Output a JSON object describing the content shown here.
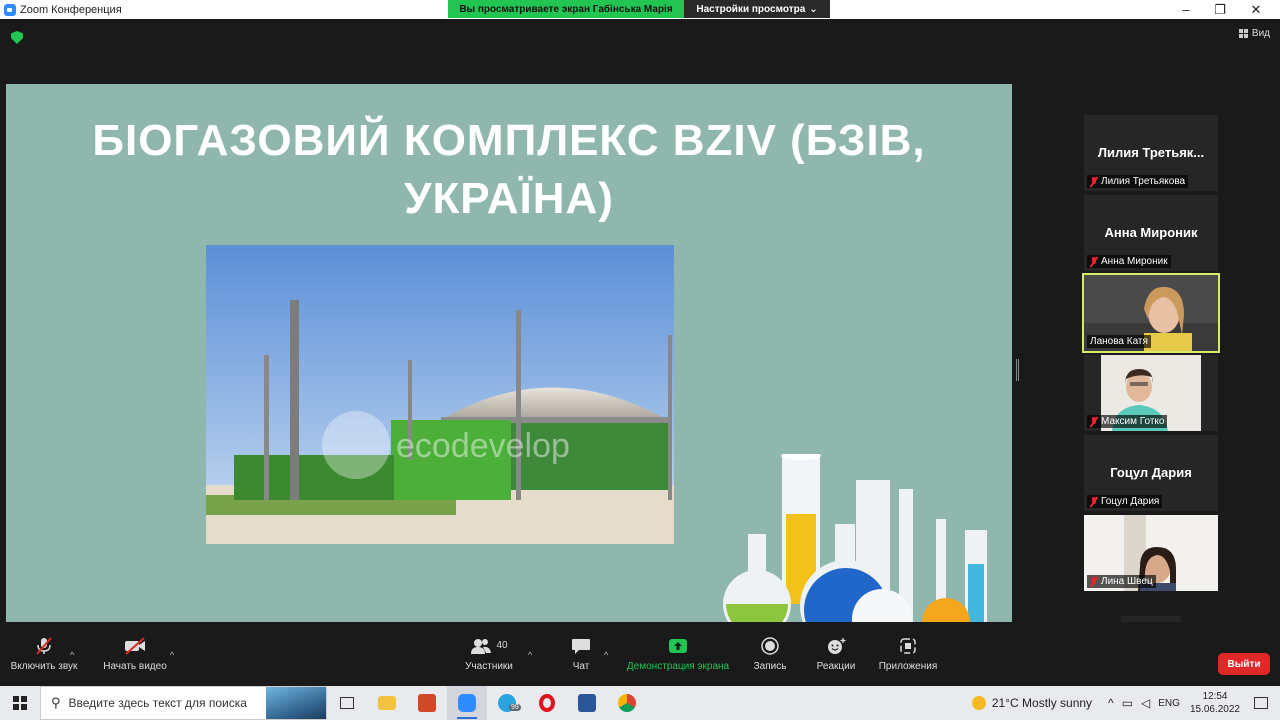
{
  "window": {
    "title": "Zoom Конференция",
    "share_banner": "Вы просматриваете экран Габінська Марія",
    "view_options": "Настройки просмотра",
    "view_button": "Вид"
  },
  "slide": {
    "title_line1": "БІОГАЗОВИЙ КОМПЛЕКС BZIV (БЗІВ,",
    "title_line2": "УКРАЇНА)",
    "photo_watermark": "ecodevelop"
  },
  "participants": [
    {
      "display_name": "Лилия Третьяк...",
      "label": "Лилия Третьякова",
      "muted": true,
      "video": false
    },
    {
      "display_name": "Анна Мироник",
      "label": "Анна Мироник",
      "muted": true,
      "video": false
    },
    {
      "display_name": "",
      "label": "Ланова Катя",
      "muted": false,
      "video": true,
      "active": true
    },
    {
      "display_name": "",
      "label": "Максим Готко",
      "muted": true,
      "video": true
    },
    {
      "display_name": "Гоцул  Дария",
      "label": "Гоцул  Дария",
      "muted": true,
      "video": false
    },
    {
      "display_name": "",
      "label": "Лина Швец",
      "muted": true,
      "video": true
    }
  ],
  "toolbar": {
    "unmute": "Включить звук",
    "start_video": "Начать видео",
    "participants": "Участники",
    "participants_count": "40",
    "chat": "Чат",
    "share": "Демонстрация экрана",
    "record": "Запись",
    "reactions": "Реакции",
    "apps": "Приложения",
    "leave": "Выйти"
  },
  "colors": {
    "zoom_green": "#23C552",
    "leave_red": "#E02828",
    "slide_bg": "#8FB7AD",
    "active_speaker": "#D8E86A"
  },
  "taskbar": {
    "search_placeholder": "Введите здесь текст для поиска",
    "weather": "21°C  Mostly sunny",
    "language": "ENG",
    "time": "12:54",
    "date": "15.06.2022",
    "telegram_badge": "99"
  }
}
